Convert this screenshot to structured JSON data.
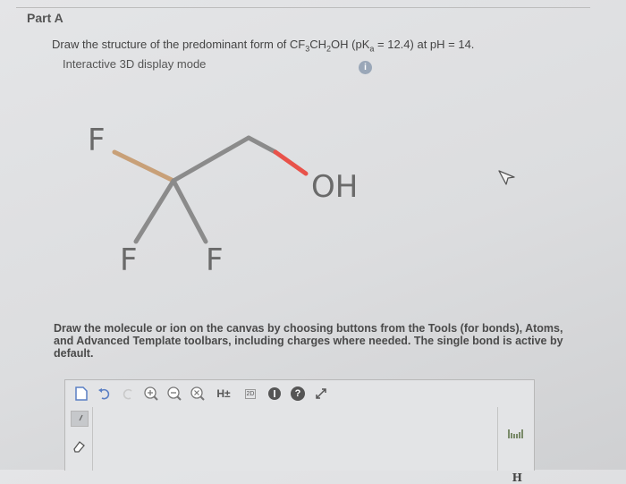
{
  "header": {
    "part_label": "Part A"
  },
  "question": {
    "prefix": "Draw the structure of the predominant form of CF",
    "sub1": "3",
    "mid1": "CH",
    "sub2": "2",
    "mid2": "OH (pK",
    "sub3": "a",
    "suffix": " = 12.4) at pH = 14."
  },
  "mode_label": "Interactive 3D display mode",
  "info_icon_text": "i",
  "molecule": {
    "atoms": [
      "F",
      "F",
      "F",
      "OH"
    ],
    "bond_colors": {
      "carbon": "#8b8b8b",
      "fluorine": "#c8a078",
      "oxygen": "#e8524a"
    }
  },
  "instructions": "Draw the molecule or ion on the canvas by choosing buttons from the Tools (for bonds), Atoms, and Advanced Template toolbars, including charges where needed. The single bond is active by default.",
  "toolbar": {
    "h_toggle": "H±",
    "label_2d": "2D",
    "help": "?",
    "h_atom": "H"
  }
}
